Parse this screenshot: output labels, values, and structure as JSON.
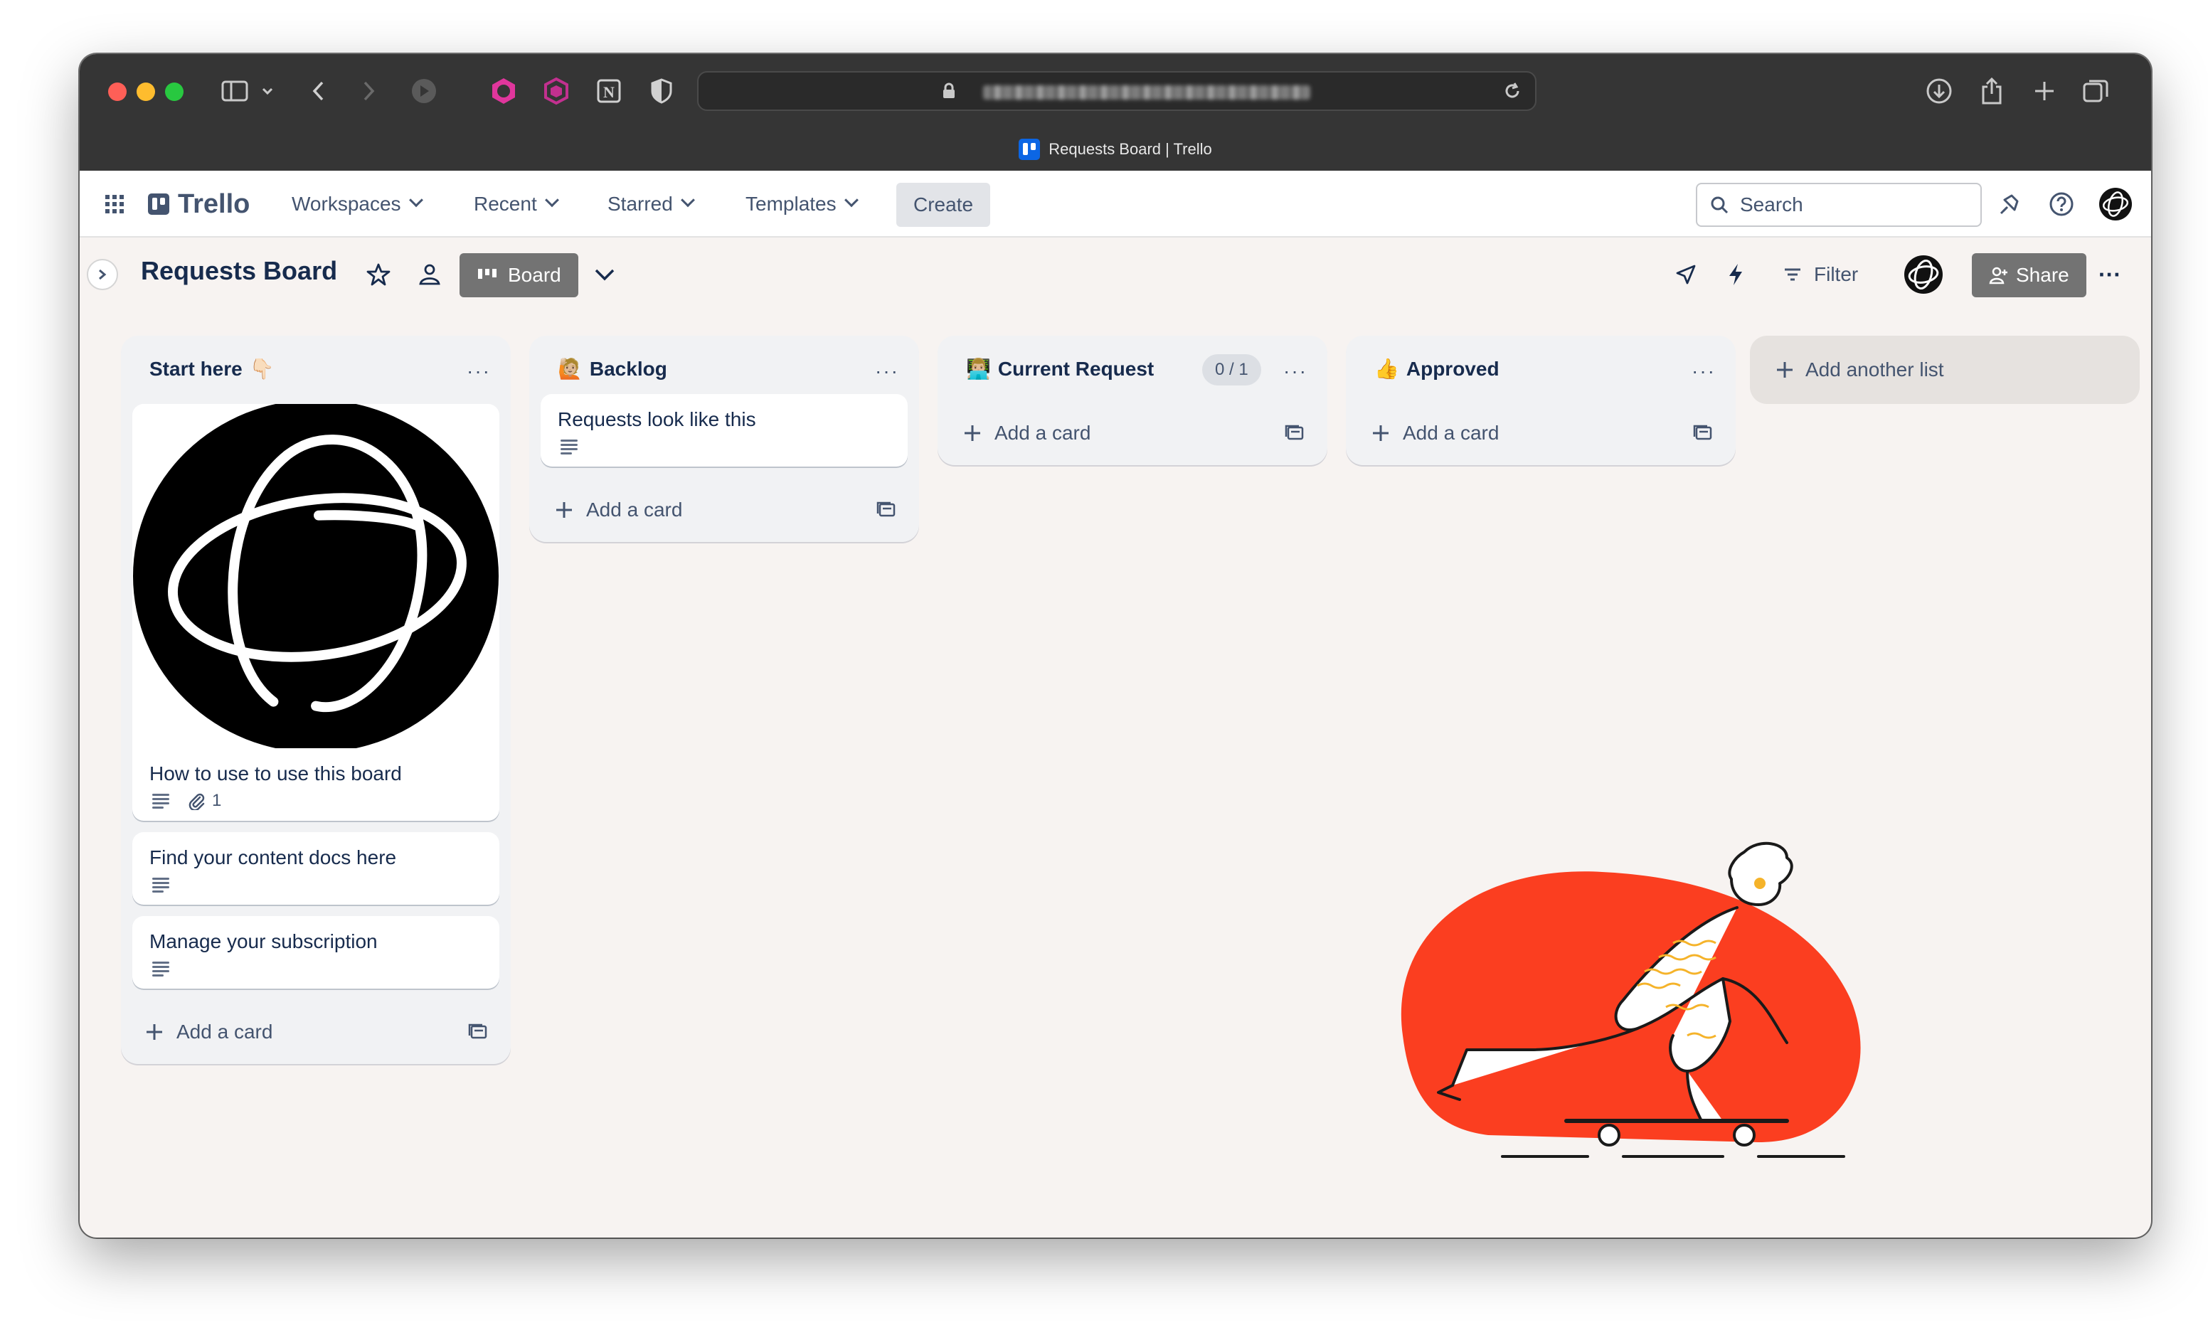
{
  "browser": {
    "tab_title": "Requests Board | Trello",
    "icons": [
      "sidebar-icon",
      "back-icon",
      "forward-icon",
      "extension-icons",
      "lock-icon",
      "reload-icon",
      "download-icon",
      "share-icon",
      "new-tab-icon",
      "tabs-overview-icon"
    ]
  },
  "header": {
    "logo": "Trello",
    "nav": {
      "workspaces": "Workspaces",
      "recent": "Recent",
      "starred": "Starred",
      "templates": "Templates"
    },
    "create": "Create",
    "search_placeholder": "Search"
  },
  "board": {
    "title": "Requests Board",
    "view": "Board",
    "filter": "Filter",
    "share": "Share"
  },
  "lists": [
    {
      "title": "Start here",
      "emoji": "👇🏻",
      "cards": [
        {
          "title": "How to use to use this board",
          "attachments": "1"
        },
        {
          "title": "Find your content docs here"
        },
        {
          "title": "Manage your subscription"
        }
      ],
      "add_card": "Add a card"
    },
    {
      "title": "Backlog",
      "emoji": "🙋🏼",
      "cards": [
        {
          "title": "Requests look like this"
        }
      ],
      "add_card": "Add a card"
    },
    {
      "title": "Current Request",
      "emoji": "👨🏼‍💻",
      "limit": "0 / 1",
      "add_card": "Add a card"
    },
    {
      "title": "Approved",
      "emoji": "👍",
      "add_card": "Add a card"
    }
  ],
  "add_list": "Add another list",
  "colors": {
    "board_bg": "#f7f3f1",
    "illustration_blob": "#fb3e20",
    "accent_blue": "#0c66e4"
  }
}
